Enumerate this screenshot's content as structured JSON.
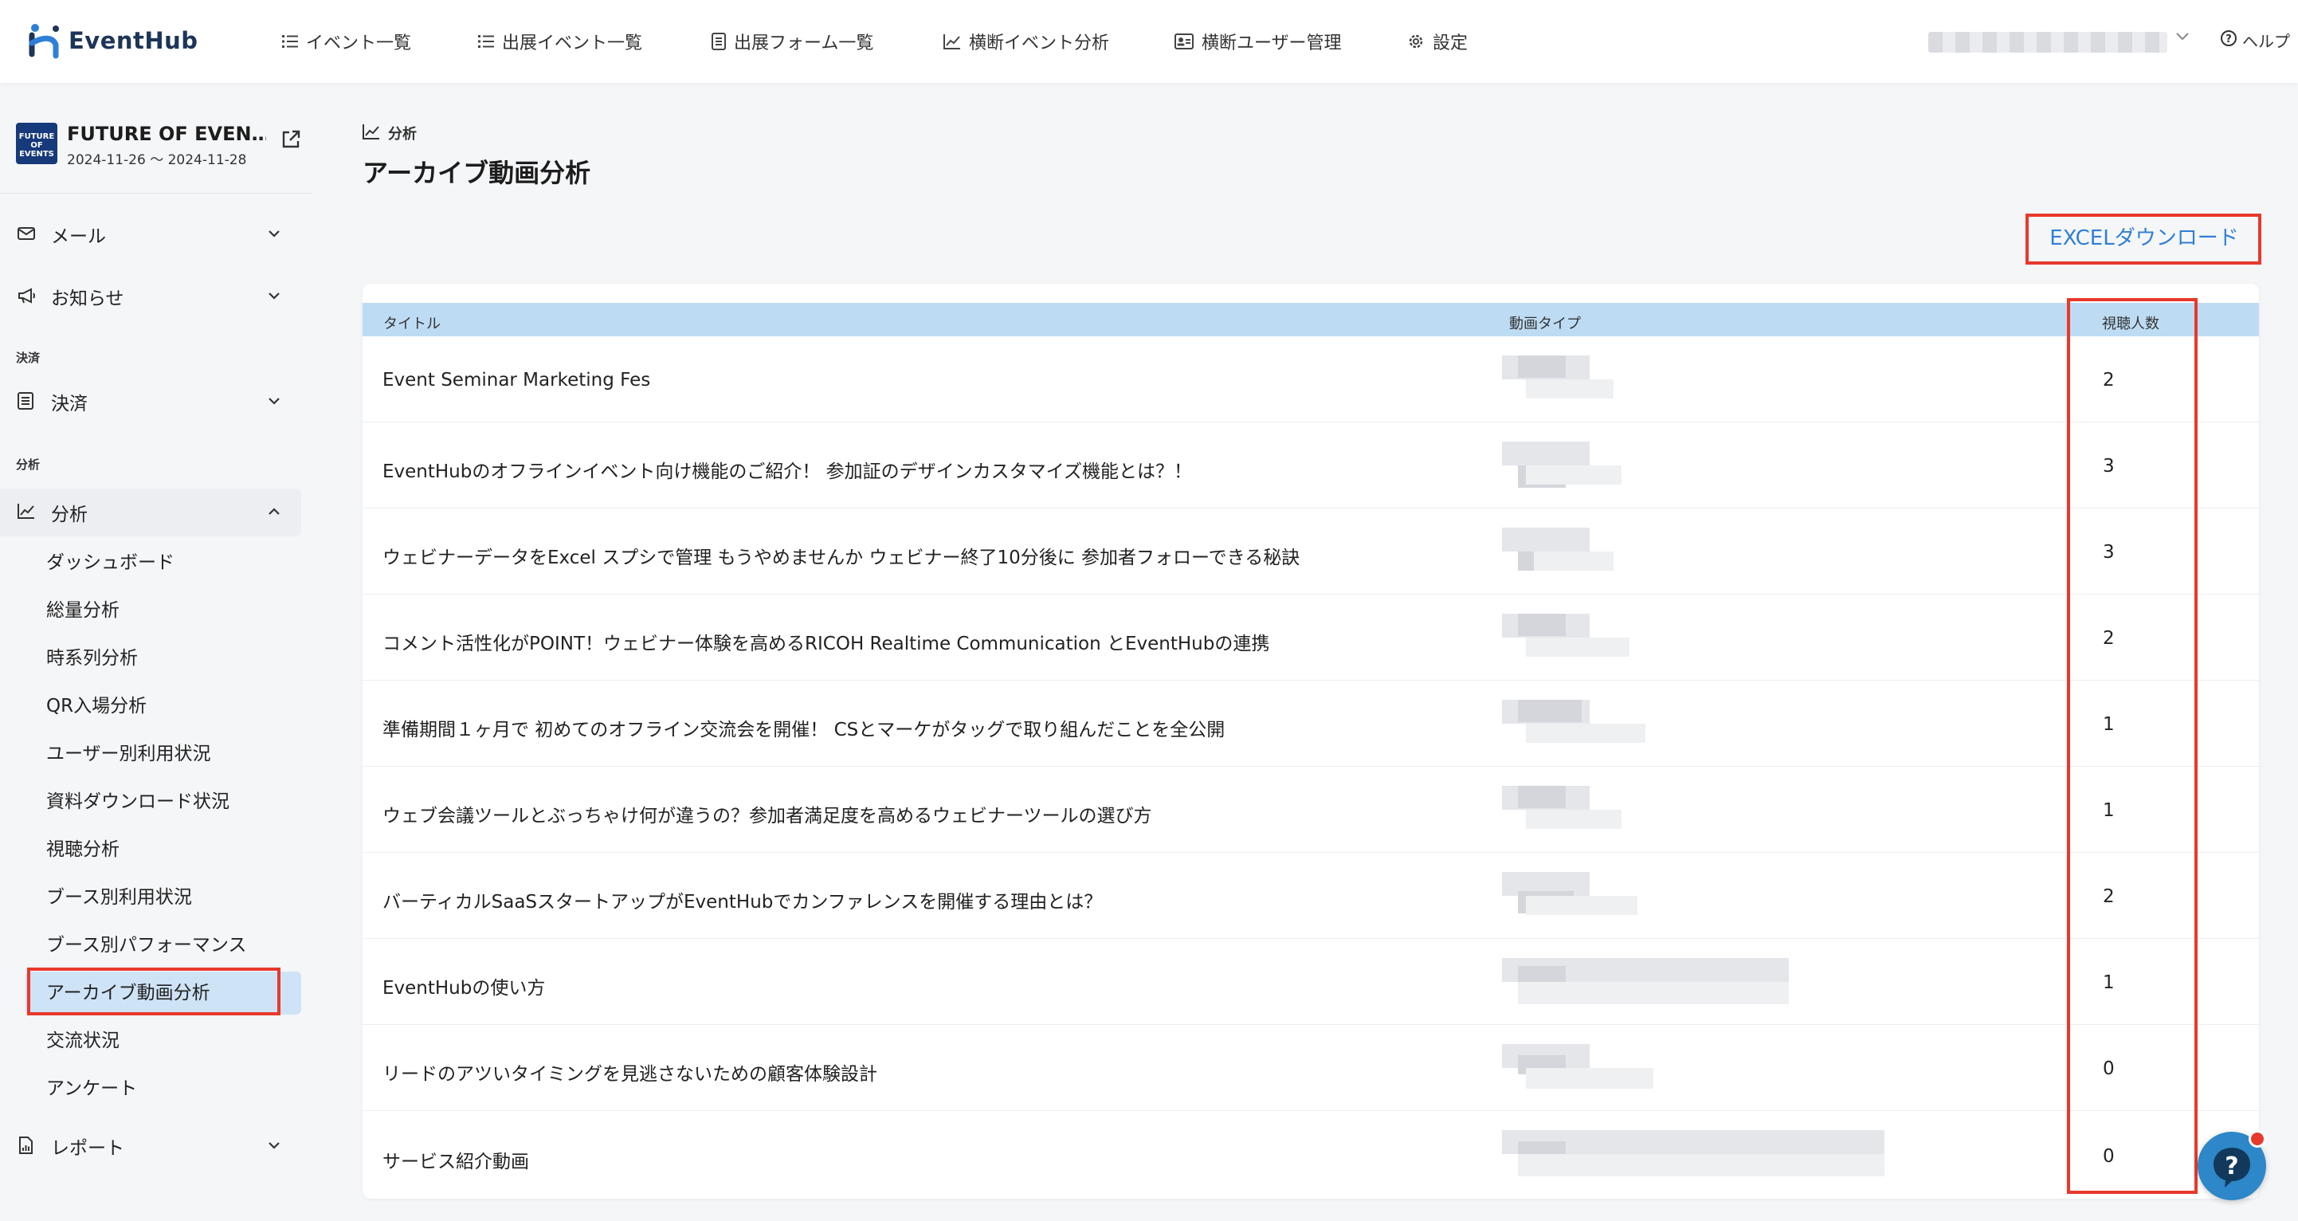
{
  "brand": {
    "name": "EventHub"
  },
  "nav": {
    "items": [
      {
        "label": "イベント一覧",
        "icon": "list-icon"
      },
      {
        "label": "出展イベント一覧",
        "icon": "list-icon"
      },
      {
        "label": "出展フォーム一覧",
        "icon": "form-icon"
      },
      {
        "label": "横断イベント分析",
        "icon": "chart-icon"
      },
      {
        "label": "横断ユーザー管理",
        "icon": "id-card-icon"
      },
      {
        "label": "設定",
        "icon": "gear-icon"
      }
    ],
    "help": "ヘルプ"
  },
  "event": {
    "thumb": "FUTURE OF EVENTS",
    "title": "FUTURE OF EVEN…",
    "dates": "2024-11-26 ～ 2024-11-28"
  },
  "sidebar": {
    "mail": "メール",
    "news": "お知らせ",
    "section_payment": "決済",
    "payment": "決済",
    "section_analysis": "分析",
    "analysis": "分析",
    "analysis_items": [
      "ダッシュボード",
      "総量分析",
      "時系列分析",
      "QR入場分析",
      "ユーザー別利用状況",
      "資料ダウンロード状況",
      "視聴分析",
      "ブース別利用状況",
      "ブース別パフォーマンス",
      "アーカイブ動画分析",
      "交流状況",
      "アンケート"
    ],
    "active_item": "アーカイブ動画分析",
    "report": "レポート"
  },
  "main": {
    "breadcrumb": "分析",
    "title": "アーカイブ動画分析",
    "excel_download": "EXCELダウンロード"
  },
  "table": {
    "headers": {
      "title": "タイトル",
      "video_type": "動画タイプ",
      "views": "視聴人数"
    },
    "rows": [
      {
        "title": "Event Seminar Marketing Fes",
        "views": "2"
      },
      {
        "title": "EventHubのオフラインイベント向け機能のご紹介！ 参加証のデザインカスタマイズ機能とは？！",
        "views": "3"
      },
      {
        "title": "ウェビナーデータをExcel スプシで管理 もうやめませんか ウェビナー終了10分後に 参加者フォローできる秘訣",
        "views": "3"
      },
      {
        "title": "コメント活性化がPOINT！ウェビナー体験を高めるRICOH Realtime Communication とEventHubの連携",
        "views": "2"
      },
      {
        "title": "準備期間１ヶ月で 初めてのオフライン交流会を開催！ CSとマーケがタッグで取り組んだことを全公開",
        "views": "1"
      },
      {
        "title": "ウェブ会議ツールとぶっちゃけ何が違うの？参加者満足度を高めるウェビナーツールの選び方",
        "views": "1"
      },
      {
        "title": "バーティカルSaaSスタートアップがEventHubでカンファレンスを開催する理由とは？",
        "views": "2"
      },
      {
        "title": "EventHubの使い方",
        "views": "1"
      },
      {
        "title": "リードのアツいタイミングを見逃さないための顧客体験設計",
        "views": "0"
      },
      {
        "title": "サービス紹介動画",
        "views": "0"
      }
    ]
  },
  "colors": {
    "accent": "#2f7fd6",
    "highlight": "#e8392b",
    "header_bg": "#bddcf4",
    "active_bg": "#cfe3f7"
  }
}
